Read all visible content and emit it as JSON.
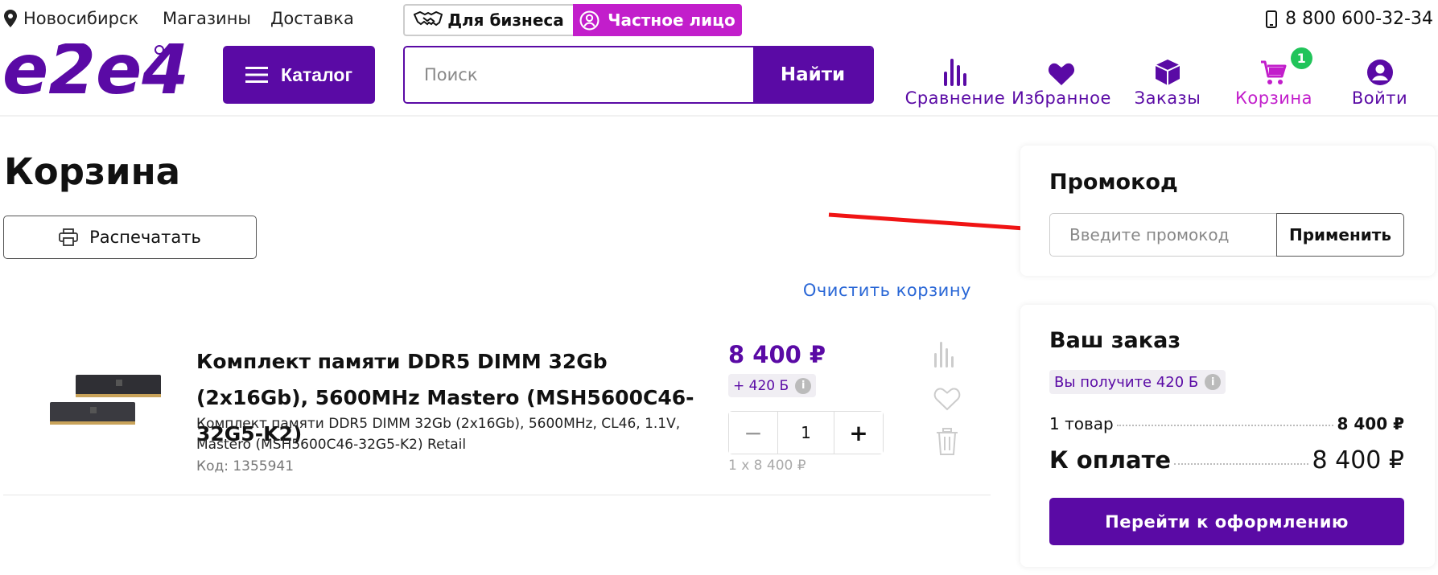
{
  "topbar": {
    "city": "Новосибирск",
    "stores": "Магазины",
    "delivery": "Доставка",
    "business_label": "Для бизнеса",
    "private_label": "Частное лицо",
    "phone": "8 800 600-32-34"
  },
  "header": {
    "logo_text": "e2e4",
    "catalog_label": "Каталог",
    "search_placeholder": "Поиск",
    "search_button": "Найти",
    "nav": {
      "compare": "Сравнение",
      "favorites": "Избранное",
      "orders": "Заказы",
      "cart": "Корзина",
      "cart_count": "1",
      "login": "Войти"
    }
  },
  "main": {
    "title": "Корзина",
    "print_label": "Распечатать",
    "clear_label": "Очистить корзину",
    "item": {
      "title": "Комплект памяти DDR5 DIMM 32Gb (2x16Gb), 5600MHz Mastero (MSH5600C46-32G5-K2)",
      "description": "Комплект памяти DDR5 DIMM 32Gb (2x16Gb), 5600MHz, CL46, 1.1V, Mastero (MSH5600C46-32G5-K2) Retail",
      "code": "Код: 1355941",
      "price": "8 400 ₽",
      "bonus": "+ 420 Б",
      "quantity": "1",
      "minus": "−",
      "plus": "+",
      "unit_price": "1 x 8 400 ₽"
    }
  },
  "promo": {
    "title": "Промокод",
    "placeholder": "Введите промокод",
    "apply_label": "Применить"
  },
  "order": {
    "title": "Ваш заказ",
    "bonus_note": "Вы получите 420 Б",
    "items_label": "1 товар",
    "items_value": "8 400 ₽",
    "total_label": "К оплате",
    "total_value": "8 400 ₽",
    "checkout_label": "Перейти к оформлению"
  },
  "colors": {
    "brand": "#5a0aa5",
    "accent": "#c21ecb",
    "badge": "#21c45a",
    "link": "#2a67d6",
    "annotation_arrow": "#f01414"
  }
}
